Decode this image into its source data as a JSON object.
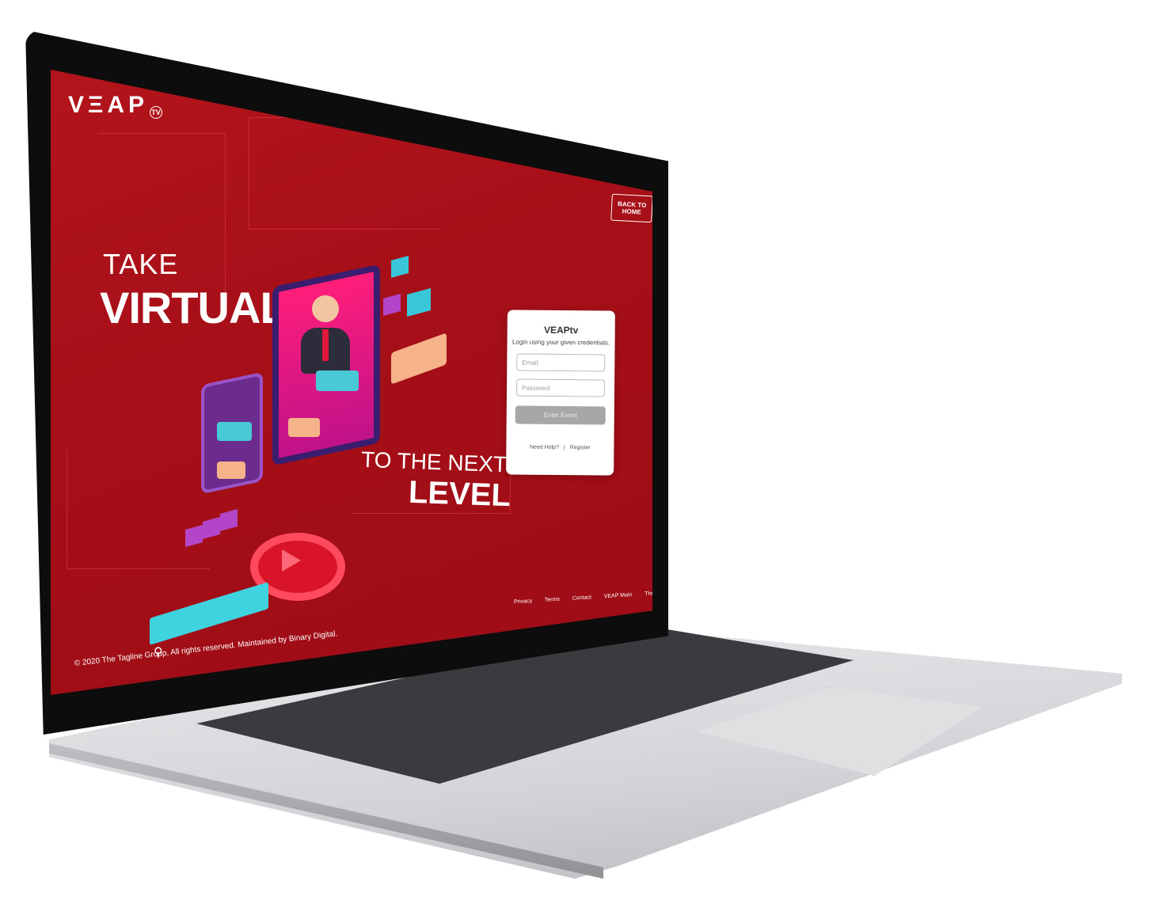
{
  "brand": {
    "logo_text": "VΞAP",
    "logo_badge": "TV"
  },
  "header": {
    "back_to_home": "BACK TO HOME"
  },
  "hero": {
    "line1": "TAKE",
    "line2": "VIRTUAL",
    "line3": "TO THE NEXT",
    "line4": "LEVEL"
  },
  "login": {
    "title": "VEAPtv",
    "subtitle": "Login using your given credentials.",
    "email_placeholder": "Email",
    "password_placeholder": "Password",
    "submit_label": "Enter Event",
    "help_link": "Need Help?",
    "separator": "|",
    "register_link": "Register"
  },
  "footer": {
    "links": [
      "Privacy",
      "Terms",
      "Contact",
      "VEAP Main",
      "The Tagline Group"
    ],
    "copyright": "© 2020 The Tagline Group, All rights reserved. Maintained by Binary Digital."
  },
  "colors": {
    "screen_background": "#a50f18",
    "button_disabled": "#a7a7a7",
    "accent_cyan": "#47c9d6",
    "accent_purple": "#b346c8"
  }
}
